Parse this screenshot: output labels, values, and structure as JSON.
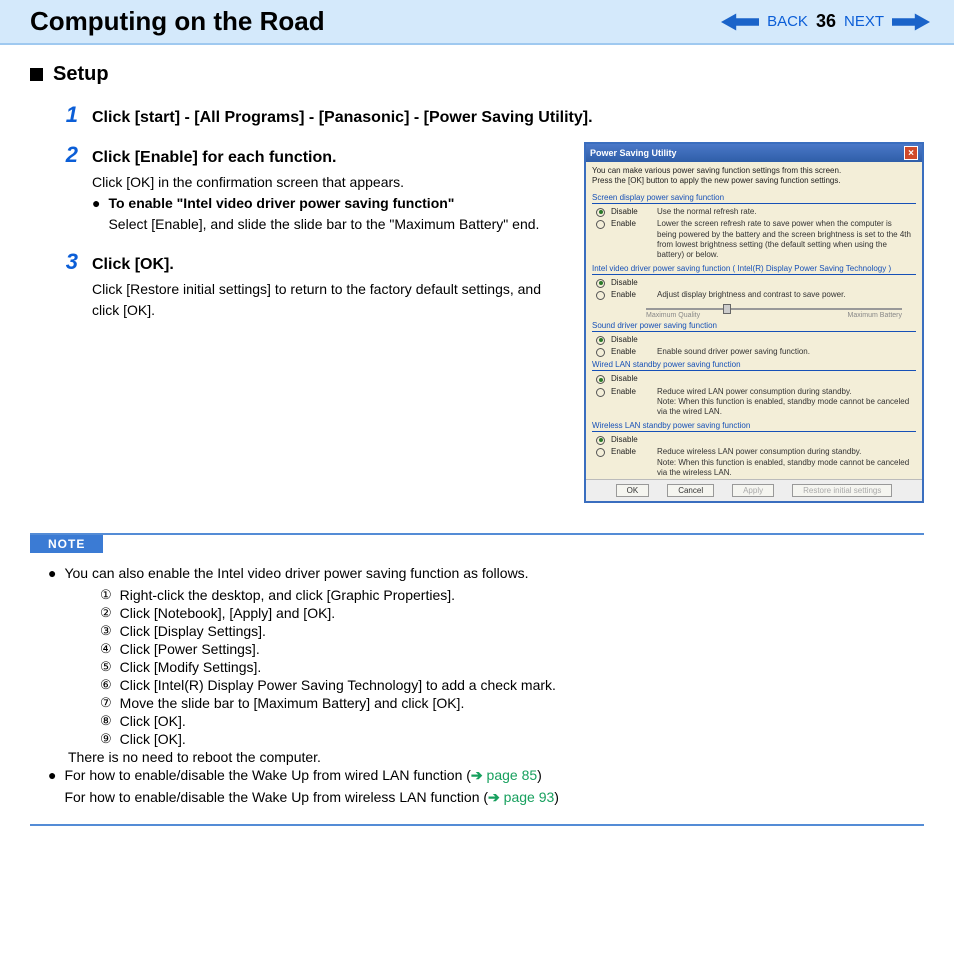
{
  "header": {
    "title": "Computing on the Road",
    "back": "BACK",
    "page": "36",
    "next": "NEXT"
  },
  "section": {
    "title": "Setup"
  },
  "steps": {
    "s1": {
      "num": "1",
      "title": "Click [start] - [All Programs] - [Panasonic] - [Power Saving Utility]."
    },
    "s2": {
      "num": "2",
      "title": "Click [Enable] for each function.",
      "line1": "Click [OK] in the confirmation screen that appears.",
      "bold": "To enable \"Intel video driver power saving function\"",
      "line2": "Select [Enable], and slide the slide bar to the \"Maximum Battery\" end."
    },
    "s3": {
      "num": "3",
      "title": "Click [OK].",
      "line1": "Click [Restore initial settings] to return to the factory default settings, and click [OK]."
    }
  },
  "dialog": {
    "title": "Power Saving Utility",
    "intro1": "You can make various power saving function settings from this screen.",
    "intro2": "Press the [OK] button to apply the new power saving function settings.",
    "groups": {
      "g1": {
        "title": "Screen display power saving function",
        "disable_desc": "Use the normal refresh rate.",
        "enable_desc": "Lower the screen refresh rate to save power when the computer is being powered by the battery and the screen brightness is set to the 4th from lowest brightness setting (the default setting when using the battery) or below."
      },
      "g2": {
        "title": "Intel video driver power saving function ( Intel(R) Display Power Saving Technology )",
        "enable_desc": "Adjust display brightness and contrast to save power.",
        "slider_left": "Maximum Quality",
        "slider_right": "Maximum Battery"
      },
      "g3": {
        "title": "Sound driver power saving function",
        "enable_desc": "Enable sound driver power saving function."
      },
      "g4": {
        "title": "Wired LAN standby power saving function",
        "enable_desc": "Reduce wired LAN power consumption during standby.",
        "enable_note": "Note: When this function is enabled, standby mode cannot be canceled via the wired LAN."
      },
      "g5": {
        "title": "Wireless LAN standby power saving function",
        "enable_desc": "Reduce wireless LAN power consumption during standby.",
        "enable_note": "Note: When this function is enabled, standby mode cannot be canceled via the wireless LAN."
      }
    },
    "labels": {
      "disable": "Disable",
      "enable": "Enable"
    },
    "buttons": {
      "ok": "OK",
      "cancel": "Cancel",
      "apply": "Apply",
      "restore": "Restore initial settings"
    }
  },
  "note": {
    "label": "NOTE",
    "intro": "You can also enable the Intel video driver power saving function as follows.",
    "items": {
      "i1": "Right-click the desktop, and click [Graphic Properties].",
      "i2": "Click [Notebook], [Apply] and [OK].",
      "i3": "Click [Display Settings].",
      "i4": "Click [Power Settings].",
      "i5": "Click [Modify Settings].",
      "i6": "Click [Intel(R) Display Power Saving Technology] to add a check mark.",
      "i7": "Move the slide bar to [Maximum Battery] and click [OK].",
      "i8": "Click [OK].",
      "i9": "Click [OK]."
    },
    "closing": "There is no need to reboot the computer.",
    "wired_pre": "For how to enable/disable the Wake Up from wired LAN function (",
    "wired_link": " page 85",
    "wired_post": ")",
    "wireless_pre": "For how to enable/disable the Wake Up from wireless LAN function (",
    "wireless_link": " page 93",
    "wireless_post": ")"
  },
  "marks": {
    "c1": "①",
    "c2": "②",
    "c3": "③",
    "c4": "④",
    "c5": "⑤",
    "c6": "⑥",
    "c7": "⑦",
    "c8": "⑧",
    "c9": "⑨"
  }
}
